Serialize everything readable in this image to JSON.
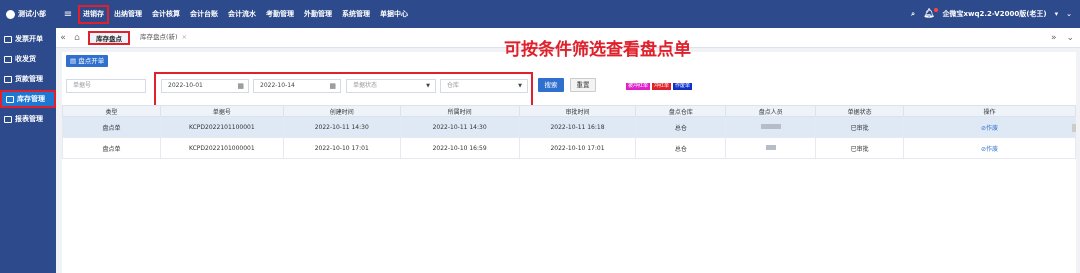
{
  "app": {
    "brand": "测试小部"
  },
  "nav": {
    "items": [
      "进销存",
      "出纳管理",
      "会计核算",
      "会计台账",
      "会计流水",
      "考勤管理",
      "外勤管理",
      "系统管理",
      "单据中心"
    ]
  },
  "topbar": {
    "user": "企微宝xwq2.2-V2000版(老王)"
  },
  "sidebar": {
    "items": [
      "发票开单",
      "收发货",
      "货款管理",
      "库存管理",
      "报表管理"
    ]
  },
  "tabs": [
    "库存盘点",
    "库存盘点(新)"
  ],
  "toolbar": {
    "create_label": "盘点开单"
  },
  "annotation": "可按条件筛选查看盘点单",
  "filters": {
    "doc_no_placeholder": "单据号",
    "date_from": "2022-10-01",
    "date_to": "2022-10-14",
    "status_placeholder": "单据状态",
    "warehouse_placeholder": "仓库",
    "search_label": "搜索",
    "reset_label": "重置"
  },
  "legend": [
    {
      "label": "被冲红单",
      "color": "#e020c8"
    },
    {
      "label": "冲红单",
      "color": "#e0202a"
    },
    {
      "label": "作废单",
      "color": "#1030c8"
    }
  ],
  "table": {
    "headers": [
      "类型",
      "单据号",
      "创建时间",
      "所属时间",
      "审批时间",
      "盘点仓库",
      "盘点人员",
      "单据状态",
      "操作"
    ],
    "rows": [
      {
        "type": "盘点单",
        "doc_no": "KCPD2022101100001",
        "created": "2022-10-11 14:30",
        "belong": "2022-10-11 14:30",
        "approved": "2022-10-11 16:18",
        "warehouse": "总仓",
        "status": "已审批",
        "action": "作废"
      },
      {
        "type": "盘点单",
        "doc_no": "KCPD2022101000001",
        "created": "2022-10-10 17:01",
        "belong": "2022-10-10 16:59",
        "approved": "2022-10-10 17:01",
        "warehouse": "总仓",
        "status": "已审批",
        "action": "作废"
      }
    ]
  }
}
